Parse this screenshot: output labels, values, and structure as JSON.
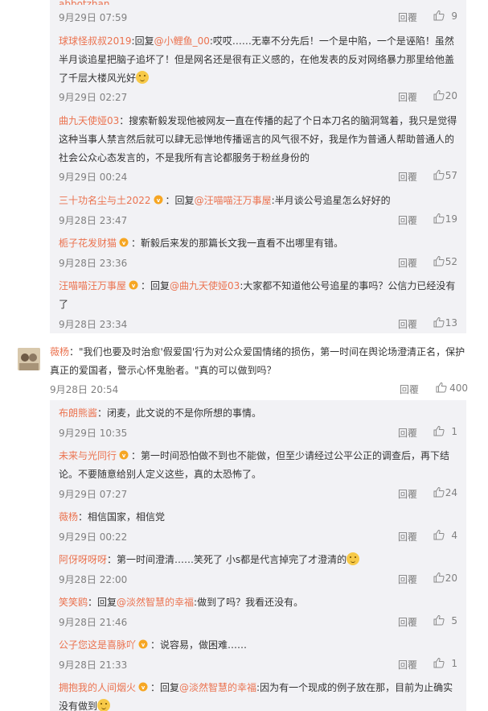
{
  "top_reply": {
    "user": "abbotzhan",
    "time": "9月29日 07:59",
    "reply_label": "回覆",
    "likes": "9"
  },
  "thread1": [
    {
      "user": "球球怪叔叔2019",
      "text_parts": [
        ":回复",
        "@小鲤鱼_00",
        ":哎哎……无辜不分先后！一个是中陷，一个是诬陷！虽然半月谈追星把脑子追坏了！但是网名还是很有正义感的，在他发表的反对网络暴力那里给他盖了千层大楼风光好"
      ],
      "time": "9月29日 02:27",
      "likes": "20"
    },
    {
      "user": "曲九天使娅03",
      "text": "：搜索靳毅发现他被网友一直在传播的起了个日本刀名的脑洞驾着，我只是觉得这种当事人禁言然后就可以肆无忌惮地传播谣言的风气很不好，我是作为普通人帮助普通人的社会公众心态发言的，不是我所有言论都服务于粉丝身份的",
      "time": "9月29日 00:24",
      "likes": "57"
    },
    {
      "user": "三十功名尘与土2022",
      "reply_prefix": "：回复",
      "mention": "@汪喵喵汪万事屋",
      "text": ":半月谈公号追星怎么好好的",
      "time": "9月28日 23:47",
      "likes": "19"
    },
    {
      "user": "栀子花发财猫",
      "text": "：靳毅后来发的那篇长文我一直看不出哪里有错。",
      "time": "9月28日 23:36",
      "likes": "52"
    },
    {
      "user": "汪喵喵汪万事屋",
      "reply_prefix": "：回复",
      "mention": "@曲九天使娅03",
      "text": ":大家都不知道他公号追星的事吗？公信力已经没有了",
      "time": "9月28日 23:34",
      "likes": "13"
    }
  ],
  "main_comment": {
    "user": "薇杨",
    "text": "：\"我们也要及时治愈'假爱国'行为对公众爱国情绪的损伤，第一时间在舆论场澄清正名，保护真正的爱国者，警示心怀鬼胎者。\"真的可以做到吗？",
    "time": "9月28日 20:54",
    "reply_label": "回覆",
    "likes": "400"
  },
  "thread2": [
    {
      "user": "布朗熊酱",
      "text": "：闭麦，此文说的不是你所想的事情。",
      "time": "9月29日 10:35",
      "likes": "1"
    },
    {
      "user": "未来与光同行",
      "text": "：第一时间恐怕做不到也不能做，但至少请经过公平公正的调查后，再下结论。不要随意给别人定义这些，真的太恐怖了。",
      "time": "9月29日 07:27",
      "likes": "24"
    },
    {
      "user": "薇杨",
      "text": "：相信国家，相信党",
      "time": "9月29日 00:22",
      "likes": "4"
    },
    {
      "user": "阿伢呀呀呀",
      "text": "：第一时间澄清……笑死了 小s都是代言掉完了才澄清的",
      "time": "9月28日 22:00",
      "likes": "20"
    },
    {
      "user": "笑笑鸥",
      "reply_prefix": "：回复",
      "mention": "@淡然智慧的幸福",
      "text": ":做到了吗？我看还没有。",
      "time": "9月28日 21:46",
      "likes": "5"
    },
    {
      "user": "公子您这是喜脉吖",
      "text": "：说容易，做困难……",
      "time": "9月28日 21:33",
      "likes": "1"
    },
    {
      "user": "拥抱我的人间烟火",
      "reply_prefix": "：回复",
      "mention": "@淡然智慧的幸福",
      "text": ":因为有一个现成的例子放在那，目前为止确实没有做到"
    }
  ],
  "labels": {
    "reply": "回覆"
  },
  "icons": {
    "like": "thumbs-up-icon",
    "vip": "vip-badge-icon",
    "emoji": "smile-emoji-icon"
  },
  "colors": {
    "username": "#eb7350",
    "meta": "#808080",
    "sub_bg": "#f2f2f5"
  }
}
